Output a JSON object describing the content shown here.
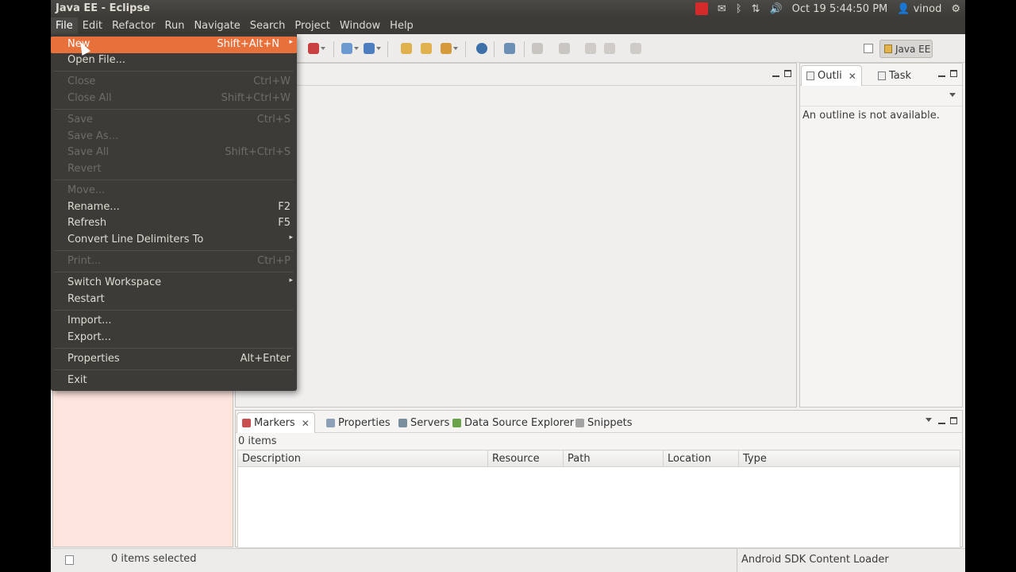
{
  "window": {
    "title": "Java EE - Eclipse"
  },
  "tray": {
    "datetime": "Oct 19  5:44:50 PM",
    "user": "vinod"
  },
  "menubar": [
    "File",
    "Edit",
    "Refactor",
    "Run",
    "Navigate",
    "Search",
    "Project",
    "Window",
    "Help"
  ],
  "file_menu": {
    "new": {
      "label": "New",
      "accel": "Shift+Alt+N"
    },
    "open_file": {
      "label": "Open File..."
    },
    "close": {
      "label": "Close",
      "accel": "Ctrl+W"
    },
    "close_all": {
      "label": "Close All",
      "accel": "Shift+Ctrl+W"
    },
    "save": {
      "label": "Save",
      "accel": "Ctrl+S"
    },
    "save_as": {
      "label": "Save As..."
    },
    "save_all": {
      "label": "Save All",
      "accel": "Shift+Ctrl+S"
    },
    "revert": {
      "label": "Revert"
    },
    "move": {
      "label": "Move..."
    },
    "rename": {
      "label": "Rename...",
      "accel": "F2"
    },
    "refresh": {
      "label": "Refresh",
      "accel": "F5"
    },
    "convert": {
      "label": "Convert Line Delimiters To"
    },
    "print": {
      "label": "Print...",
      "accel": "Ctrl+P"
    },
    "switch_workspace": {
      "label": "Switch Workspace"
    },
    "restart": {
      "label": "Restart"
    },
    "import": {
      "label": "Import..."
    },
    "export": {
      "label": "Export..."
    },
    "properties": {
      "label": "Properties",
      "accel": "Alt+Enter"
    },
    "exit": {
      "label": "Exit"
    }
  },
  "perspective": {
    "label": "Java EE"
  },
  "outline": {
    "tab_outline": "Outli",
    "tab_task": "Task",
    "message": "An outline is not available."
  },
  "bottom": {
    "tabs": [
      "Markers",
      "Properties",
      "Servers",
      "Data Source Explorer",
      "Snippets"
    ],
    "count": "0 items",
    "columns": [
      "Description",
      "Resource",
      "Path",
      "Location",
      "Type"
    ]
  },
  "status": {
    "selected": "0 items selected",
    "loader": "Android SDK Content Loader"
  },
  "colors": {
    "menu_bg": "#3c3b37",
    "highlight": "#e8703a",
    "left_pane": "#fde4dc"
  }
}
